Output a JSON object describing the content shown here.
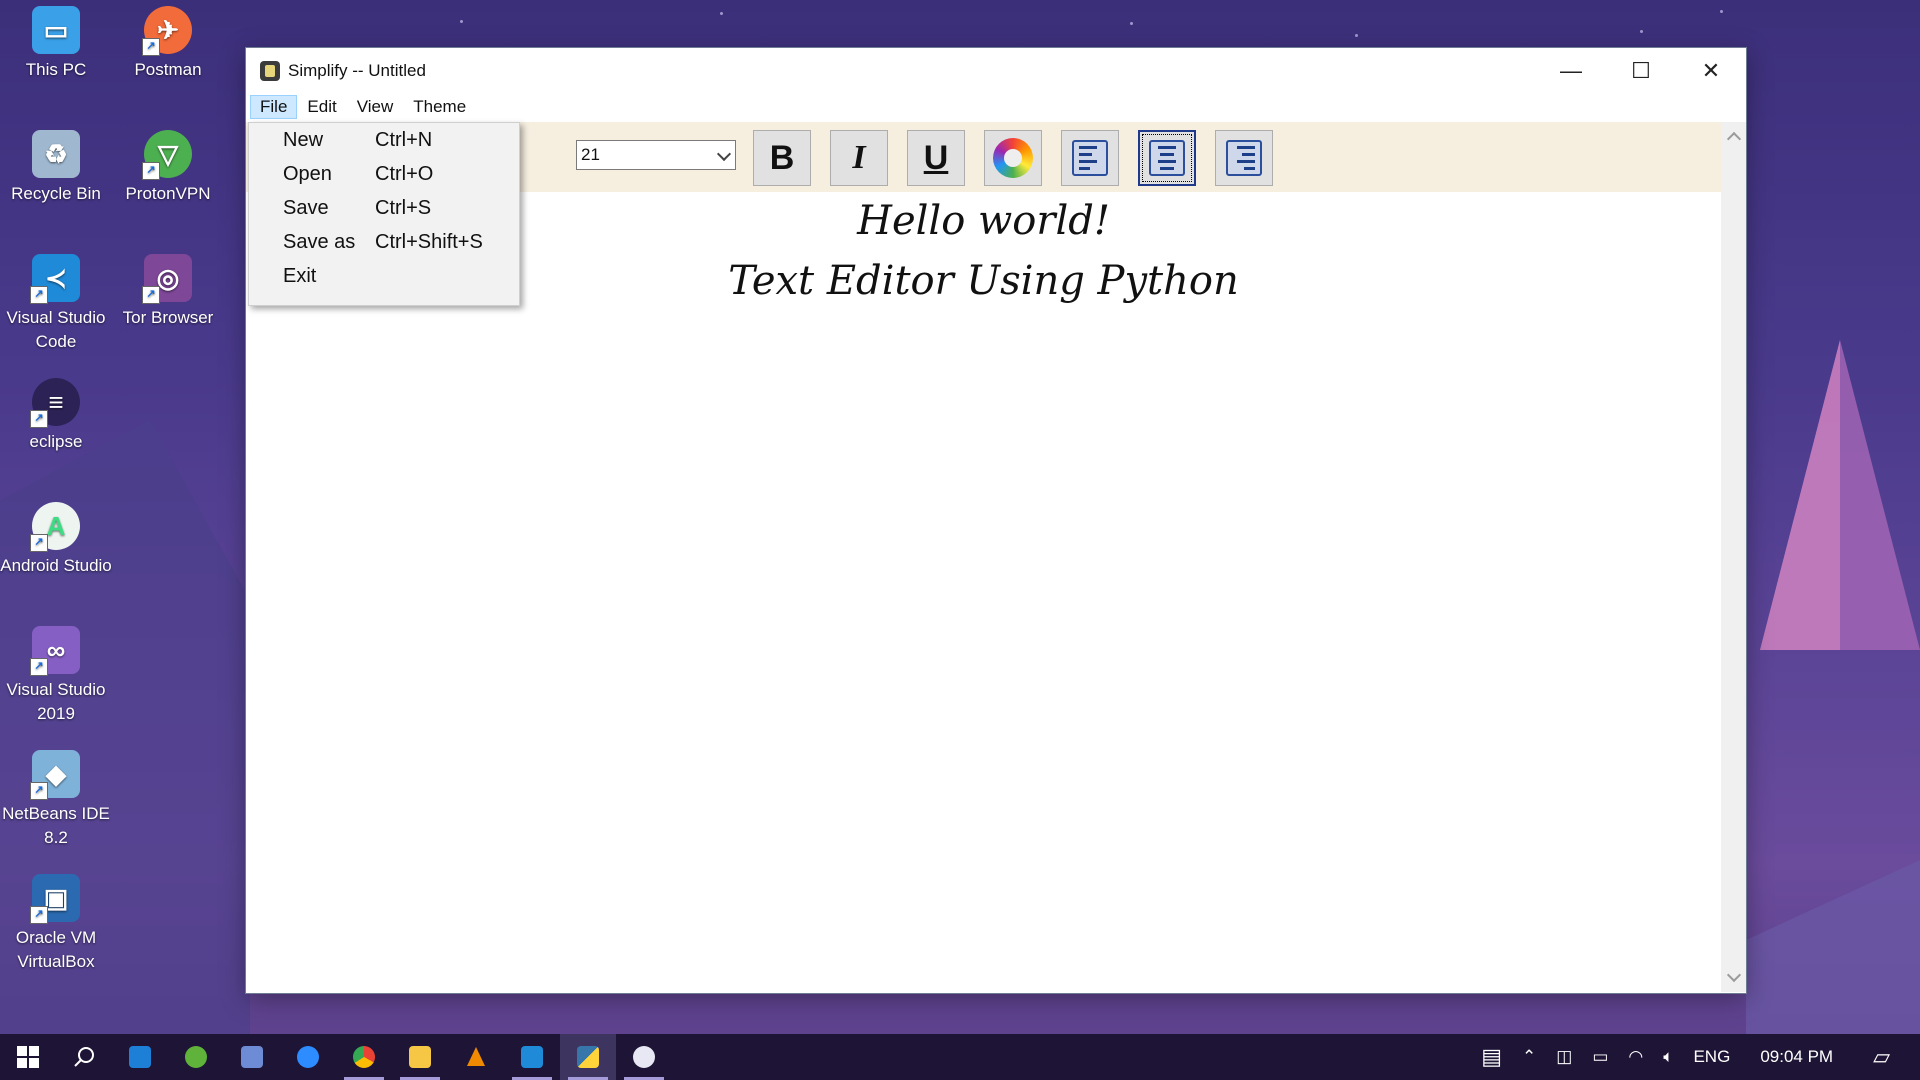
{
  "desktop": {
    "icons": [
      {
        "label": "This PC",
        "icon": "computer-icon",
        "color": "#3aa0e8"
      },
      {
        "label": "Postman",
        "icon": "postman-icon",
        "color": "#f26b3a"
      },
      {
        "label": "Recycle Bin",
        "icon": "recycle-bin-icon",
        "color": "#9fb8d0"
      },
      {
        "label": "ProtonVPN",
        "icon": "protonvpn-icon",
        "color": "#4caf50"
      },
      {
        "label": "Visual Studio Code",
        "icon": "vscode-icon",
        "color": "#1f8ad8"
      },
      {
        "label": "Tor Browser",
        "icon": "tor-browser-icon",
        "color": "#7e4798"
      },
      {
        "label": "eclipse",
        "icon": "eclipse-icon",
        "color": "#2c2255"
      },
      {
        "label": "Android Studio",
        "icon": "android-studio-icon",
        "color": "#3ddc84"
      },
      {
        "label": "Visual Studio 2019",
        "icon": "visual-studio-icon",
        "color": "#865fc5"
      },
      {
        "label": "NetBeans IDE 8.2",
        "icon": "netbeans-icon",
        "color": "#7fb2d9"
      },
      {
        "label": "Oracle VM VirtualBox",
        "icon": "virtualbox-icon",
        "color": "#2b6ab0"
      }
    ]
  },
  "window": {
    "title": "Simplify -- Untitled",
    "controls": {
      "minimize": "—",
      "maximize": "☐",
      "close": "✕"
    },
    "menu": [
      "File",
      "Edit",
      "View",
      "Theme"
    ],
    "toolbar": {
      "font_size": "21",
      "bold": "B",
      "italic": "I",
      "underline": "U"
    },
    "editor_lines": [
      "Hello world!",
      "Text Editor Using Python"
    ]
  },
  "file_menu": [
    {
      "label": "New",
      "shortcut": "Ctrl+N"
    },
    {
      "label": "Open",
      "shortcut": "Ctrl+O"
    },
    {
      "label": "Save",
      "shortcut": "Ctrl+S"
    },
    {
      "label": "Save as",
      "shortcut": "Ctrl+Shift+S"
    },
    {
      "label": "Exit",
      "shortcut": ""
    }
  ],
  "taskbar": {
    "apps": [
      "start-icon",
      "search-icon",
      "mail-icon",
      "utorrent-icon",
      "network-app-icon",
      "zoom-icon",
      "chrome-icon",
      "file-explorer-icon",
      "vlc-icon",
      "vscode-icon",
      "python-app-icon",
      "paint-icon"
    ],
    "tray": {
      "language": "ENG",
      "time": "09:04 PM"
    }
  }
}
